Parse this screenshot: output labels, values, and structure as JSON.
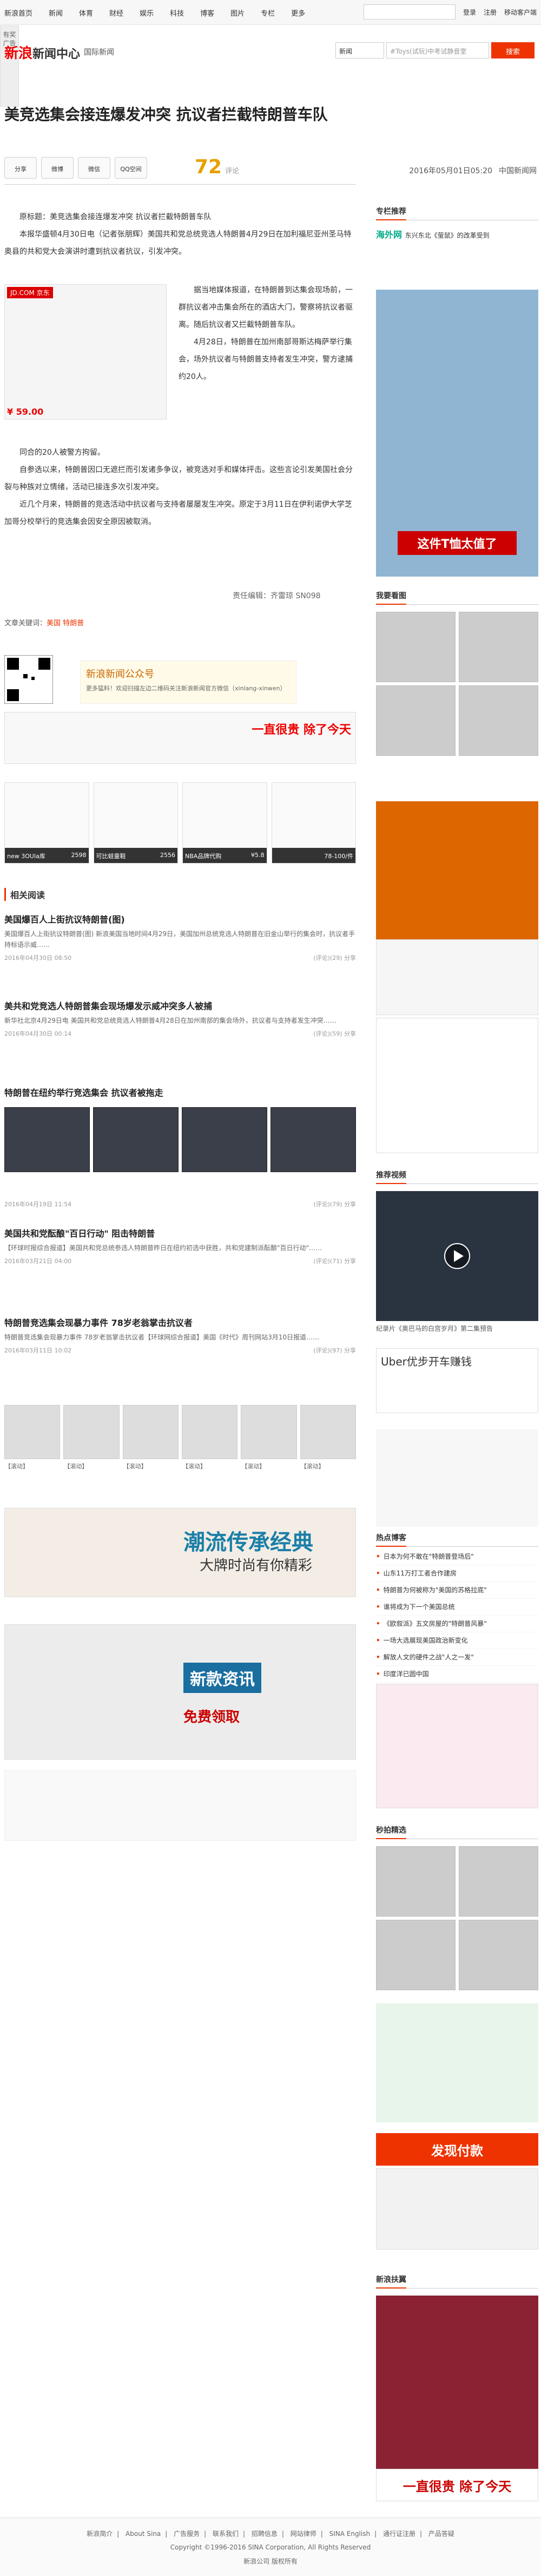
{
  "topnav": {
    "items": [
      "新浪首页",
      "新闻",
      "体育",
      "财经",
      "娱乐",
      "科技",
      "博客",
      "图片",
      "专栏",
      "更多"
    ],
    "search_placeholder": "",
    "login": "登录",
    "register": "注册",
    "mobile": "移动客户端"
  },
  "sidead": {
    "label": "有奖广告"
  },
  "brand": {
    "logo": "新浪",
    "logo2": "新闻中心",
    "channel": "国际新闻"
  },
  "hsearch": {
    "select": "新闻",
    "placeholder": "#Toys(试玩)中考试静音室",
    "btn": "搜索"
  },
  "article": {
    "title": "美竞选集会接连爆发冲突 抗议者拦截特朗普车队",
    "share": [
      "分享",
      "微博",
      "微信",
      "QQ空间"
    ],
    "comments": "72",
    "comments_label": "评论",
    "date": "2016年05月01日05:20",
    "source": "中国新闻网",
    "paragraphs": [
      "原标题：美竞选集会接连爆发冲突 抗议者拦截特朗普车队",
      "本报华盛顿4月30日电（记者张朋辉）美国共和党总统竞选人特朗普4月29日在加利福尼亚州圣马特奥县的共和党大会演讲时遭到抗议者抗议，引发冲突。",
      "据当地媒体报道，在特朗普到达集会现场前，一群抗议者冲击集会所在的酒店大门，警察将抗议者驱离。随后抗议者又拦截特朗普车队。",
      "4月28日，特朗普在加州南部哥斯达梅萨举行集会，场外抗议者与特朗普支持者发生冲突，警方逮捕约20人。",
      "同合的20人被警方拘留。",
      "自参选以来，特朗普因口无遮拦而引发诸多争议，被竞选对手和媒体抨击。这些言论引发美国社会分裂与种族对立情绪，活动已接连多次引发冲突。",
      "近几个月来，特朗普的竞选活动中抗议者与支持者屡屡发生冲突。原定于3月11日在伊利诺伊大学芝加哥分校举行的竞选集会因安全原因被取消。"
    ],
    "product": {
      "tag": "JD.COM 京东",
      "price": "¥ 59.00"
    },
    "editor": "责任编辑：齐雷琼 SN098",
    "tags_label": "文章关键词：",
    "tags": "美国 特朗普",
    "qr_label": "新浪新闻公众号",
    "qr_sub": "更多猛料！欢迎扫描左边二维码关注新浪新闻官方微信（xinlang-xinwen）",
    "ad_text": "一直很贵 除了今天",
    "products": [
      {
        "name": "new 3OUla库",
        "price": "2598"
      },
      {
        "name": "可比蛙童鞋",
        "price": "2556"
      },
      {
        "name": "NBA品牌代购",
        "price": "¥5.8"
      },
      {
        "name": "",
        "price": "78-100/件"
      }
    ]
  },
  "related": {
    "title": "相关阅读",
    "items": [
      {
        "title": "美国爆百人上街抗议特朗普(图)",
        "desc": "美国爆百人上街抗议特朗普(图) 新浪美国当地时间4月29日，美国加州总统竞选人特朗普在旧金山举行的集会时，抗议者手持标语示威……",
        "meta_l": "2016年04月30日 08:50",
        "meta_r": "(评论)(29) 分享"
      },
      {
        "title": "美共和党竞选人特朗普集会现场爆发示威冲突多人被捕",
        "desc": "新华社北京4月29日电 美国共和党总统竞选人特朗普4月28日在加州南部的集会场外，抗议者与支持者发生冲突……",
        "meta_l": "2016年04月30日 00:14",
        "meta_r": "(评论)(59) 分享"
      },
      {
        "title": "特朗普在纽约举行竞选集会 抗议者被拖走",
        "desc": "",
        "meta_l": "2016年04月19日 11:54",
        "meta_r": "(评论)(79) 分享"
      },
      {
        "title": "美国共和党酝酿\"百日行动\" 阻击特朗普",
        "desc": "【环球时报综合报道】美国共和党总统参选人特朗普昨日在纽约初选中获胜，共和党建制派酝酿\"百日行动\"……",
        "meta_l": "2016年03月21日 04:00",
        "meta_r": "(评论)(71) 分享"
      },
      {
        "title": "特朗普竞选集会现暴力事件 78岁老翁掌击抗议者",
        "desc": "特朗普竞选集会现暴力事件 78岁老翁掌击抗议者【环球网综合报道】美国《时代》周刊网站3月10日报道……",
        "meta_l": "2016年03月11日 10:02",
        "meta_r": "(评论)(97) 分享"
      }
    ]
  },
  "thumbs": [
    "【滚动】",
    "【滚动】",
    "【滚动】",
    "【滚动】",
    "【滚动】",
    "【滚动】"
  ],
  "bigad": {
    "headline": "潮流传承经典",
    "sub": "大牌时尚有你精彩"
  },
  "bigad2": {
    "headline": "新款资讯",
    "sub": "免费领取"
  },
  "right": {
    "hot_recommend": "专栏推荐",
    "hwwatch": "东兴东北《萤鼠》的改革受到",
    "ad_banner": "这件T恤太值了",
    "my_reading": "我要看图",
    "video": "推荐视频",
    "video_cap": "纪录片《奥巴马的白宫岁月》第二集预告",
    "uber": "Uber优步开车赚钱",
    "hot_blog": "热点博客",
    "hot_list": [
      "日本为何不敢在\"特朗普登场后\"",
      "山东11万打工者合作建房",
      "特朗普为何被称为\"美国的苏格拉底\"",
      "谁将成为下一个美国总统",
      "《欧叙派》五文房屋的\"特朗普风暴\"",
      "一场大选展现美国政治新变化",
      "解放人文的硬件之战\"人之一发\"",
      "印度洋已圆中国"
    ],
    "shop_label": "秒拍精选",
    "sale_btn": "发现付款",
    "sale2": "一直很贵 除了今天",
    "new_label": "新浪扶翼"
  },
  "footer": {
    "links": [
      "新浪简介",
      "About Sina",
      "广告服务",
      "联系我们",
      "招聘信息",
      "网站律师",
      "SINA English",
      "通行证注册",
      "产品答疑"
    ],
    "copyright": "Copyright ©1996-2016 SINA Corporation, All Rights Reserved",
    "company": "新浪公司 版权所有"
  }
}
